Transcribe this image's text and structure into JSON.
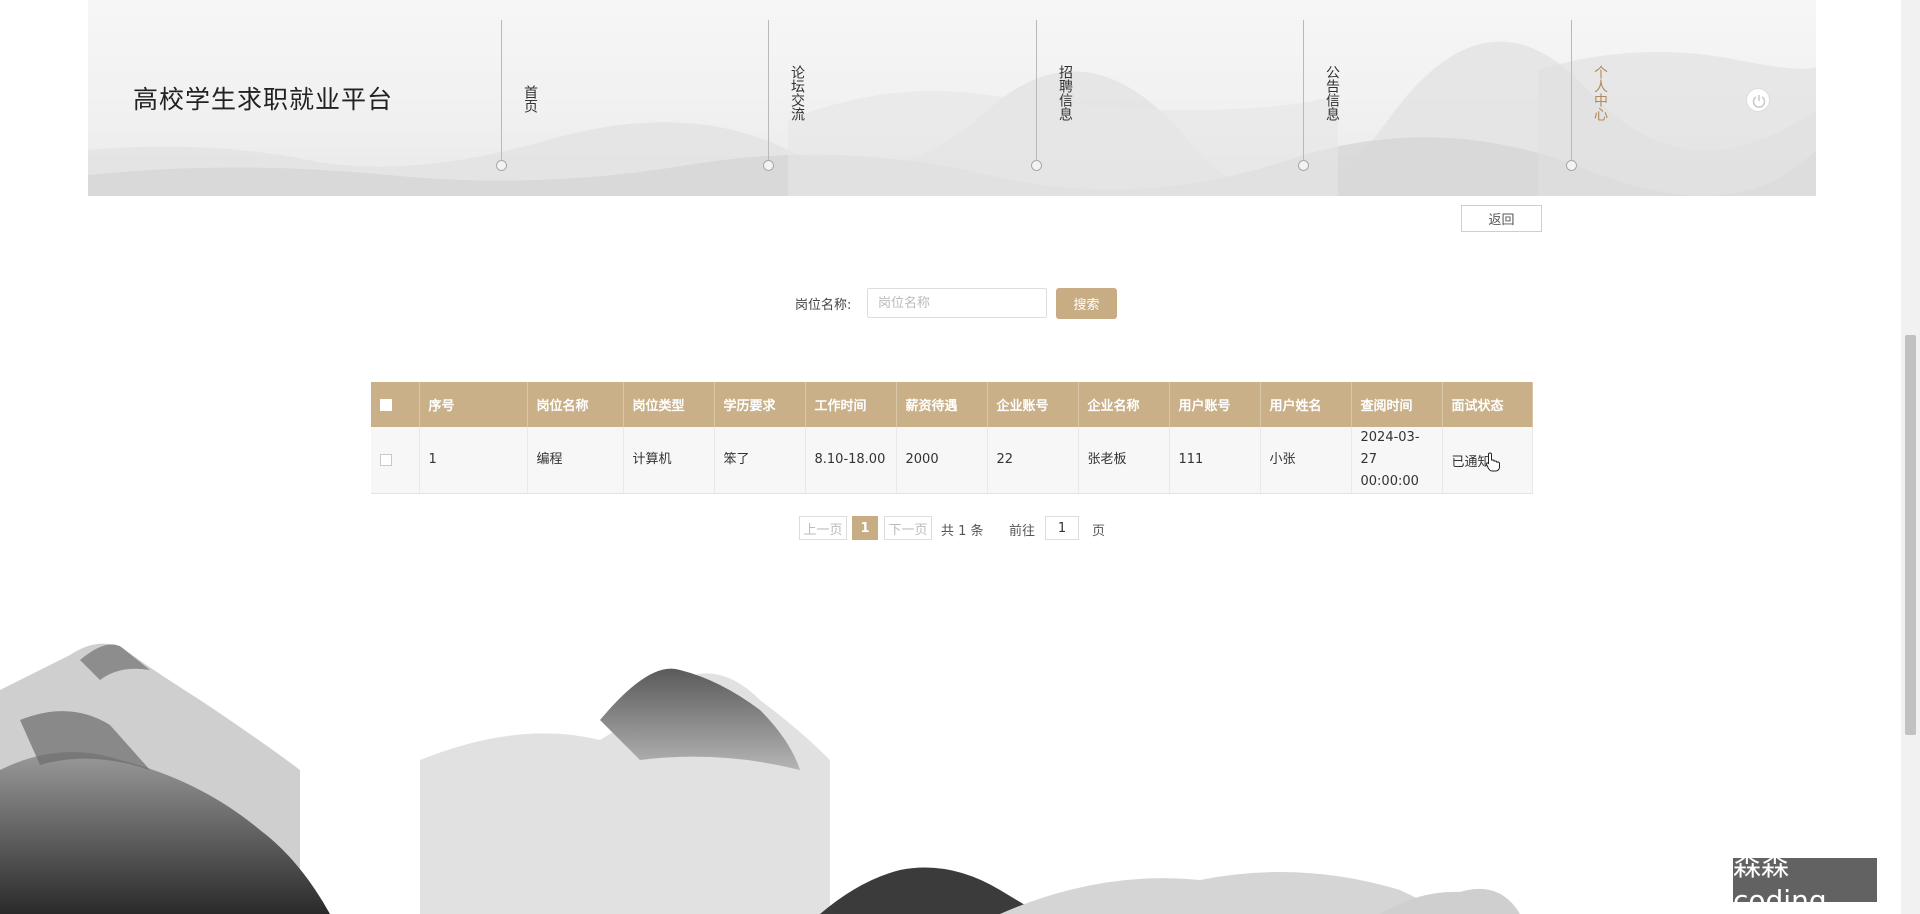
{
  "header": {
    "site_title": "高校学生求职就业平台",
    "nav": [
      {
        "label": "首页",
        "active": false
      },
      {
        "label": "论坛交流",
        "active": false
      },
      {
        "label": "招聘信息",
        "active": false
      },
      {
        "label": "公告信息",
        "active": false
      },
      {
        "label": "个人中心",
        "active": true
      }
    ],
    "power_icon": "power-icon"
  },
  "back_button": "返回",
  "search": {
    "label": "岗位名称:",
    "placeholder": "岗位名称",
    "value": "",
    "button": "搜索"
  },
  "table": {
    "columns": [
      "序号",
      "岗位名称",
      "岗位类型",
      "学历要求",
      "工作时间",
      "薪资待遇",
      "企业账号",
      "企业名称",
      "用户账号",
      "用户姓名",
      "查阅时间",
      "面试状态"
    ],
    "rows": [
      {
        "index": "1",
        "job_name": "编程",
        "job_type": "计算机",
        "education": "笨了",
        "work_time": "8.10-18.00",
        "salary": "2000",
        "company_account": "22",
        "company_name": "张老板",
        "user_account": "111",
        "user_name": "小张",
        "view_date": "2024-03-27",
        "view_time": "00:00:00",
        "status": "已通知"
      }
    ]
  },
  "pager": {
    "prev": "上一页",
    "current": "1",
    "next": "下一页",
    "total": "共 1 条",
    "goto_label": "前往",
    "goto_value": "1",
    "page_suffix": "页"
  },
  "watermark": "森森coding",
  "colors": {
    "accent": "#c7ac84",
    "table_header": "#c9b088",
    "active_nav": "#b08a5c"
  }
}
